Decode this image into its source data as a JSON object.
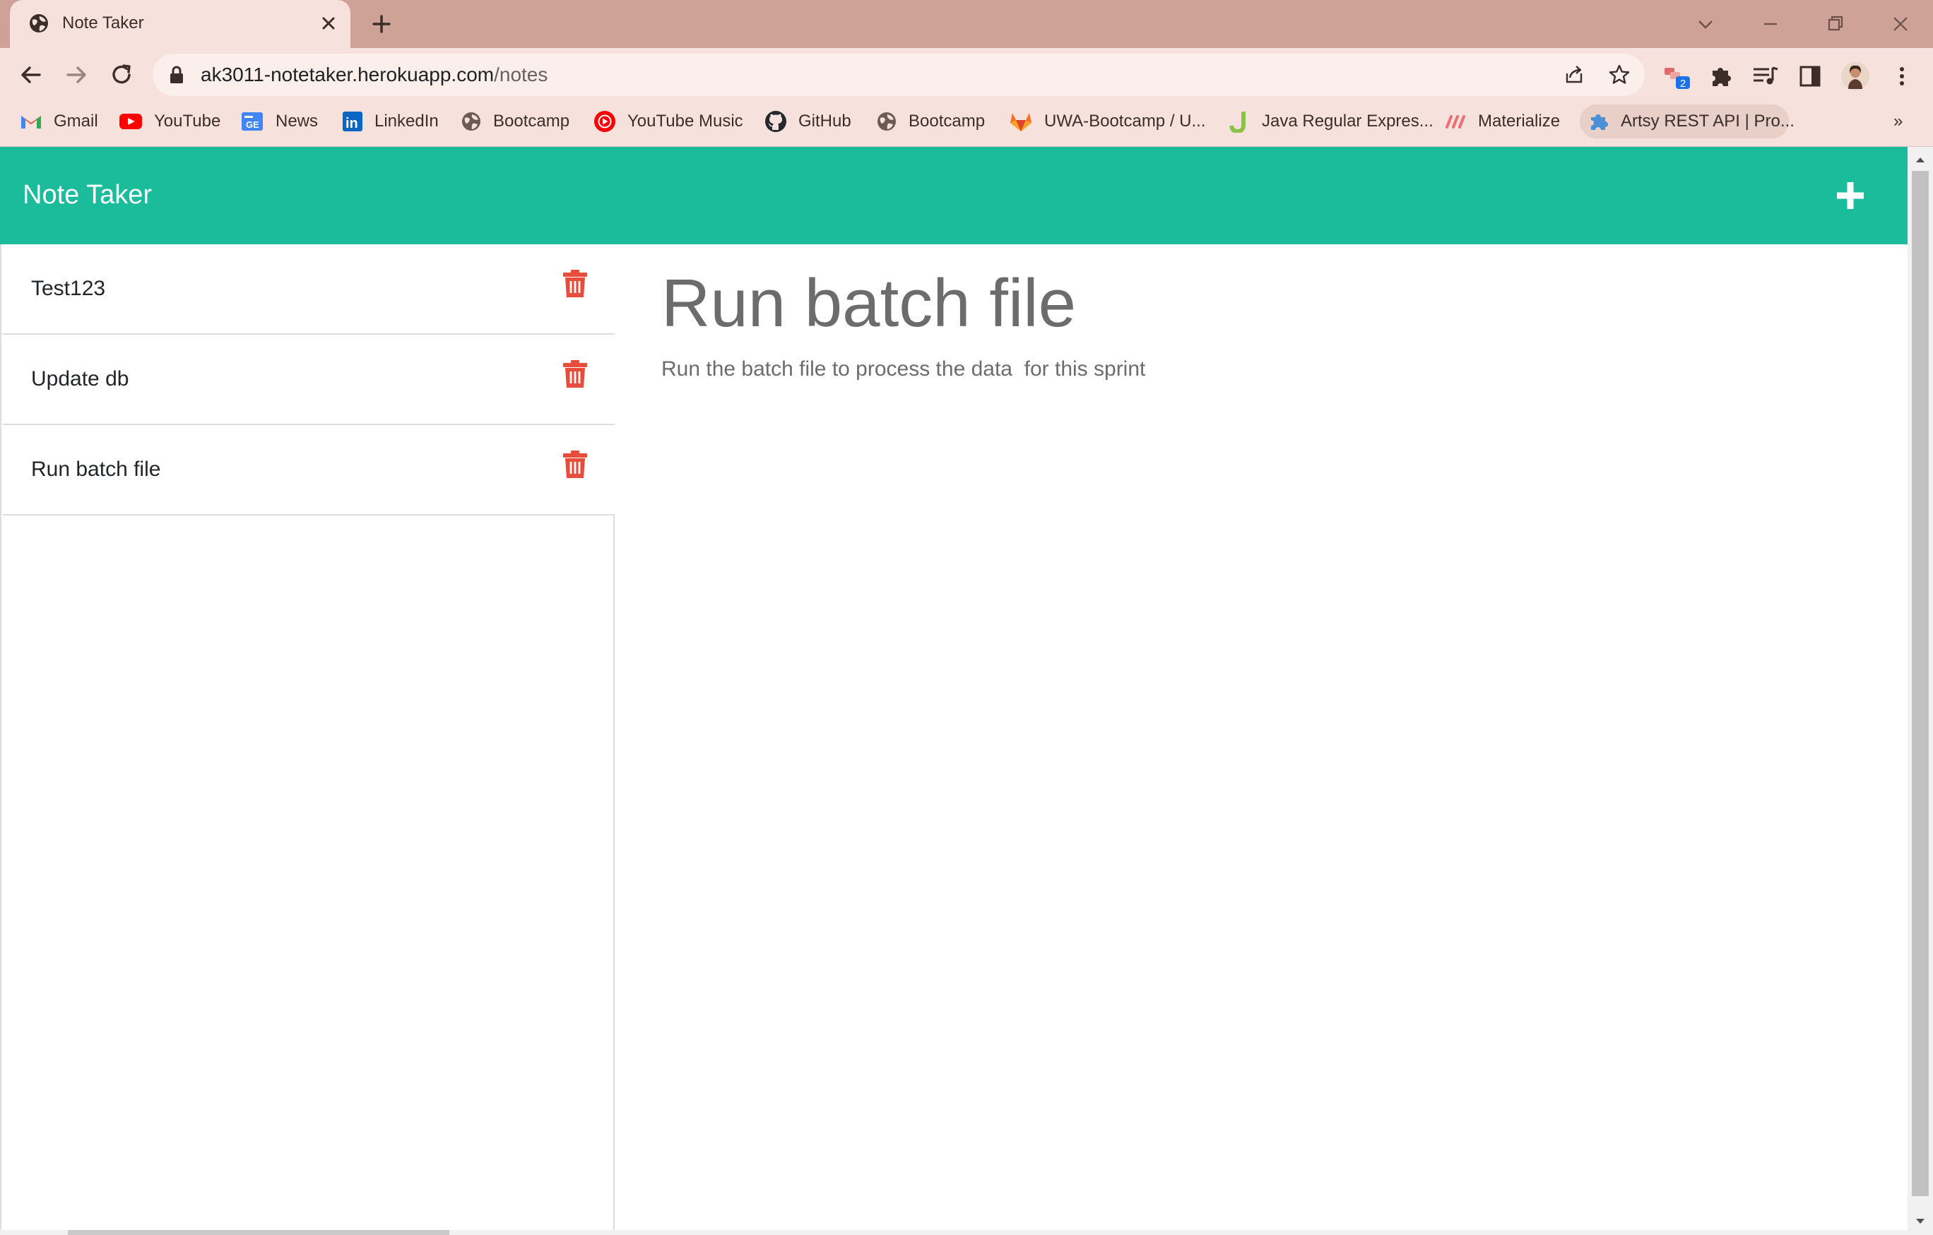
{
  "browser": {
    "tab_title": "Note Taker",
    "url_host": "ak3011-notetaker.herokuapp.com",
    "url_path": "/notes",
    "extension_badge": "2",
    "bookmarks": [
      {
        "label": "Gmail",
        "icon": "gmail-icon"
      },
      {
        "label": "YouTube",
        "icon": "youtube-icon"
      },
      {
        "label": "News",
        "icon": "news-icon"
      },
      {
        "label": "LinkedIn",
        "icon": "linkedin-icon"
      },
      {
        "label": "Bootcamp",
        "icon": "globe-icon"
      },
      {
        "label": "YouTube Music",
        "icon": "youtube-music-icon"
      },
      {
        "label": "GitHub",
        "icon": "github-icon"
      },
      {
        "label": "Bootcamp",
        "icon": "globe-icon"
      },
      {
        "label": "UWA-Bootcamp / U...",
        "icon": "gitlab-icon"
      },
      {
        "label": "Java Regular Expres...",
        "icon": "j-icon"
      },
      {
        "label": "Materialize",
        "icon": "materialize-icon"
      },
      {
        "label": "Artsy REST API | Pro...",
        "icon": "puzzle-icon"
      }
    ],
    "overflow": "»"
  },
  "app": {
    "brand": "Note Taker",
    "accent_color": "#1abc9c",
    "delete_color": "#e74c3c",
    "notes": [
      {
        "title": "Test123"
      },
      {
        "title": "Update db"
      },
      {
        "title": "Run batch file"
      }
    ],
    "active_note": {
      "title": "Run batch file",
      "text": "Run the batch file to process the data  for this sprint"
    }
  }
}
